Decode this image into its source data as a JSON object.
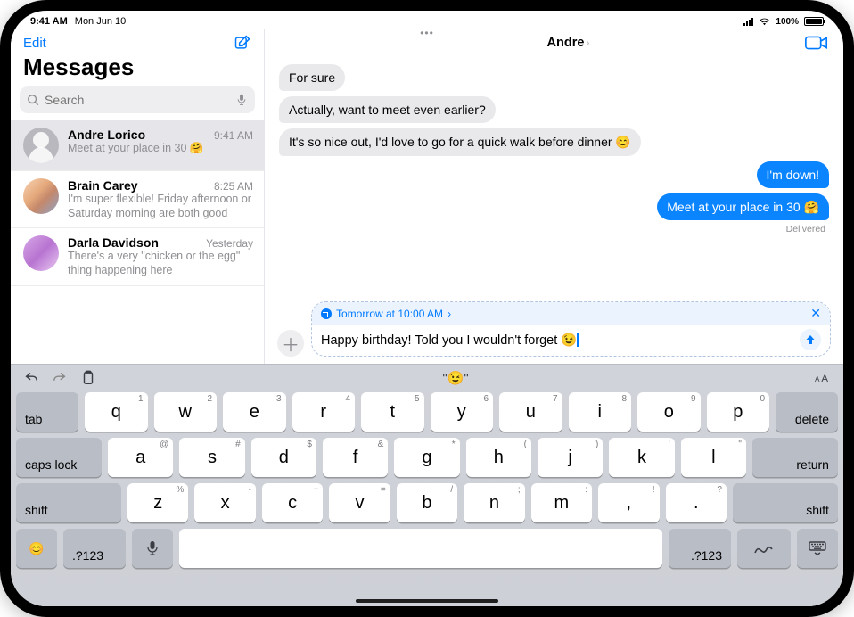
{
  "status": {
    "time": "9:41 AM",
    "date": "Mon Jun 10",
    "signal_label": "signal-4",
    "wifi_label": "wifi",
    "battery_percent": "100%"
  },
  "sidebar": {
    "edit_label": "Edit",
    "title": "Messages",
    "search_placeholder": "Search",
    "conversations": [
      {
        "name": "Andre Lorico",
        "time": "9:41 AM",
        "preview": "Meet at your place in 30 🤗",
        "selected": true,
        "avatar": "silhouette"
      },
      {
        "name": "Brain Carey",
        "time": "8:25 AM",
        "preview": "I'm super flexible! Friday afternoon or Saturday morning are both good",
        "selected": false,
        "avatar": "photo1"
      },
      {
        "name": "Darla Davidson",
        "time": "Yesterday",
        "preview": "There's a very \"chicken or the egg\" thing happening here",
        "selected": false,
        "avatar": "photo2"
      }
    ]
  },
  "chat": {
    "title": "Andre",
    "messages": [
      {
        "dir": "in",
        "text": "For sure"
      },
      {
        "dir": "in",
        "text": "Actually, want to meet even earlier?"
      },
      {
        "dir": "in",
        "text": "It's so nice out, I'd love to go for a quick walk before dinner 😊"
      },
      {
        "dir": "out",
        "text": "I'm down!"
      },
      {
        "dir": "out",
        "text": "Meet at your place in 30 🤗"
      }
    ],
    "delivered_label": "Delivered",
    "send_later_label": "Tomorrow at 10:00 AM",
    "compose_text": "Happy birthday! Told you I wouldn't forget 😉"
  },
  "keyboard": {
    "suggestion": "\"😉\"",
    "row1": [
      {
        "main": "q",
        "sub": "1"
      },
      {
        "main": "w",
        "sub": "2"
      },
      {
        "main": "e",
        "sub": "3"
      },
      {
        "main": "r",
        "sub": "4"
      },
      {
        "main": "t",
        "sub": "5"
      },
      {
        "main": "y",
        "sub": "6"
      },
      {
        "main": "u",
        "sub": "7"
      },
      {
        "main": "i",
        "sub": "8"
      },
      {
        "main": "o",
        "sub": "9"
      },
      {
        "main": "p",
        "sub": "0"
      }
    ],
    "row2": [
      {
        "main": "a",
        "sub": "@"
      },
      {
        "main": "s",
        "sub": "#"
      },
      {
        "main": "d",
        "sub": "$"
      },
      {
        "main": "f",
        "sub": "&"
      },
      {
        "main": "g",
        "sub": "*"
      },
      {
        "main": "h",
        "sub": "("
      },
      {
        "main": "j",
        "sub": ")"
      },
      {
        "main": "k",
        "sub": "'"
      },
      {
        "main": "l",
        "sub": "\""
      }
    ],
    "row3": [
      {
        "main": "z",
        "sub": "%"
      },
      {
        "main": "x",
        "sub": "-"
      },
      {
        "main": "c",
        "sub": "+"
      },
      {
        "main": "v",
        "sub": "="
      },
      {
        "main": "b",
        "sub": "/"
      },
      {
        "main": "n",
        "sub": ";"
      },
      {
        "main": "m",
        "sub": ":"
      },
      {
        "main": ",",
        "sub": "!"
      },
      {
        "main": ".",
        "sub": "?"
      }
    ],
    "tab_label": "tab",
    "delete_label": "delete",
    "caps_label": "caps lock",
    "return_label": "return",
    "shift_label": "shift",
    "numsym_label": ".?123"
  }
}
